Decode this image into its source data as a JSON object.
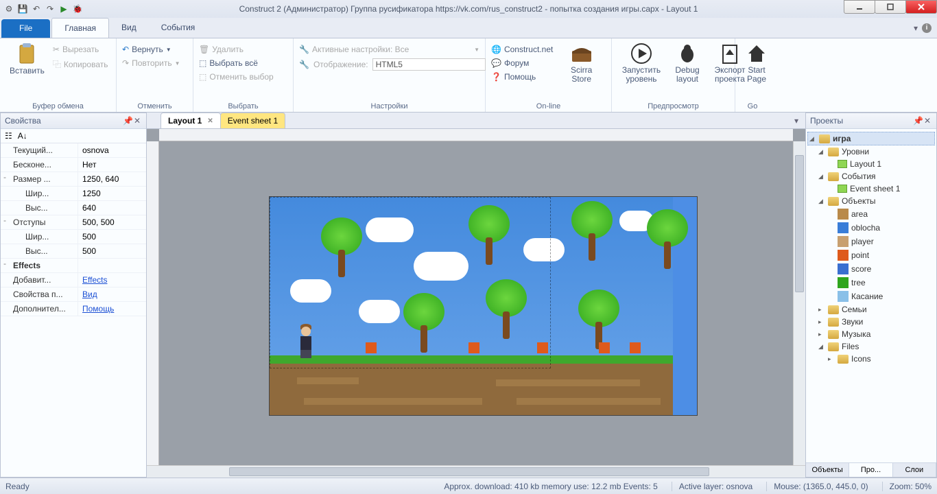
{
  "title": "Construct 2 (Администратор) Группа русификатора https://vk.com/rus_construct2 - попытка создания игры.capx - Layout 1",
  "menu": {
    "file": "File",
    "tabs": [
      "Главная",
      "Вид",
      "События"
    ],
    "active_tab": 0
  },
  "ribbon": {
    "clipboard": {
      "paste": "Вставить",
      "cut": "Вырезать",
      "copy": "Копировать",
      "label": "Буфер обмена"
    },
    "undo": {
      "undo": "Вернуть",
      "redo": "Повторить",
      "label": "Отменить"
    },
    "select": {
      "delete": "Удалить",
      "select_all": "Выбрать всё",
      "deselect": "Отменить выбор",
      "label": "Выбрать"
    },
    "settings": {
      "active": "Активные настройки: Все",
      "display_label": "Отображение:",
      "display_value": "HTML5",
      "label": "Настройки"
    },
    "online": {
      "construct_net": "Construct.net",
      "forum": "Форум",
      "help": "Помощь",
      "scirra_store": "Scirra Store",
      "label": "On-line"
    },
    "preview": {
      "run": "Запустить уровень",
      "debug": "Debug layout",
      "export": "Экспорт проекта",
      "label": "Предпросмотр"
    },
    "go": {
      "start": "Start Page",
      "label": "Go"
    }
  },
  "tabs": [
    {
      "label": "Layout 1",
      "active": true
    },
    {
      "label": "Event sheet 1",
      "active": false
    }
  ],
  "properties_panel": {
    "title": "Свойства",
    "rows": [
      {
        "key": "Текущий...",
        "val": "osnova",
        "indent": 1
      },
      {
        "key": "Бесконе...",
        "val": "Нет",
        "indent": 1
      },
      {
        "key": "Размер ...",
        "val": "1250, 640",
        "expander": "-",
        "indent": 0
      },
      {
        "key": "Шир...",
        "val": "1250",
        "indent": 2
      },
      {
        "key": "Выс...",
        "val": "640",
        "indent": 2
      },
      {
        "key": "Отступы",
        "val": "500, 500",
        "expander": "-",
        "indent": 0
      },
      {
        "key": "Шир...",
        "val": "500",
        "indent": 2
      },
      {
        "key": "Выс...",
        "val": "500",
        "indent": 2
      },
      {
        "key": "Effects",
        "section": true,
        "expander": "-",
        "indent": 0
      },
      {
        "key": "Добавит...",
        "val": "Effects",
        "link": true,
        "indent": 1
      },
      {
        "key": "Свойства п...",
        "val": "Вид",
        "link": true,
        "indent": 0
      },
      {
        "key": "Дополнител...",
        "val": "Помощь",
        "link": true,
        "indent": 0
      }
    ]
  },
  "projects_panel": {
    "title": "Проекты",
    "tree": [
      {
        "label": "игра",
        "type": "folder",
        "indent": 0,
        "open": true,
        "selected": true,
        "bold": true
      },
      {
        "label": "Уровни",
        "type": "folder",
        "indent": 1,
        "open": true
      },
      {
        "label": "Layout 1",
        "type": "layout",
        "indent": 2
      },
      {
        "label": "События",
        "type": "folder",
        "indent": 1,
        "open": true
      },
      {
        "label": "Event sheet 1",
        "type": "event",
        "indent": 2
      },
      {
        "label": "Объекты",
        "type": "folder",
        "indent": 1,
        "open": true
      },
      {
        "label": "area",
        "type": "obj",
        "indent": 2,
        "icon_color": "#b98a4a"
      },
      {
        "label": "oblocha",
        "type": "obj",
        "indent": 2,
        "icon_color": "#3a7dd8"
      },
      {
        "label": "player",
        "type": "obj",
        "indent": 2,
        "icon_color": "#c8a070"
      },
      {
        "label": "point",
        "type": "obj",
        "indent": 2,
        "icon_color": "#de5a1c"
      },
      {
        "label": "score",
        "type": "obj",
        "indent": 2,
        "icon_color": "#3a6fd0"
      },
      {
        "label": "tree",
        "type": "obj",
        "indent": 2,
        "icon_color": "#2fa51d"
      },
      {
        "label": "Касание",
        "type": "obj",
        "indent": 2,
        "icon_color": "#8ac0e8"
      },
      {
        "label": "Семьи",
        "type": "folder",
        "indent": 1
      },
      {
        "label": "Звуки",
        "type": "folder",
        "indent": 1
      },
      {
        "label": "Музыка",
        "type": "folder",
        "indent": 1
      },
      {
        "label": "Files",
        "type": "folder",
        "indent": 1,
        "open": true
      },
      {
        "label": "Icons",
        "type": "folder",
        "indent": 2,
        "toggle": "▸"
      }
    ],
    "tabs": [
      "Объекты",
      "Про...",
      "Слои"
    ],
    "active_tab": 1
  },
  "status": {
    "ready": "Ready",
    "approx": "Approx. download: 410 kb   memory use: 12.2 mb   Events: 5",
    "layer": "Active layer: osnova",
    "mouse": "Mouse: (1365.0, 445.0, 0)",
    "zoom": "Zoom: 50%"
  }
}
